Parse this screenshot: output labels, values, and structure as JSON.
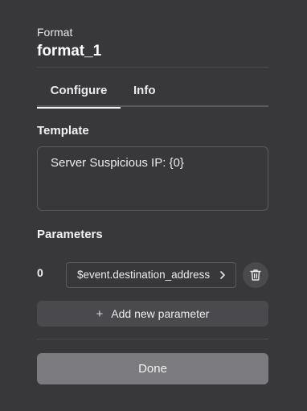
{
  "header": {
    "kicker": "Format",
    "title": "format_1"
  },
  "tabs": [
    {
      "label": "Configure",
      "active": true
    },
    {
      "label": "Info",
      "active": false
    }
  ],
  "template": {
    "label": "Template",
    "value": "Server Suspicious IP: {0}"
  },
  "parameters": {
    "label": "Parameters",
    "items": [
      {
        "index": "0",
        "value": "$event.destination_address"
      }
    ],
    "add_label": "Add new parameter"
  },
  "footer": {
    "done_label": "Done"
  },
  "icons": {
    "chevron": "chevron-right-icon",
    "delete": "trash-icon",
    "add": "plus-icon"
  },
  "colors": {
    "background": "#38383b",
    "button_surface": "#4a4a4e",
    "done_button": "#7b7b7f",
    "text": "#f2f2f2"
  }
}
